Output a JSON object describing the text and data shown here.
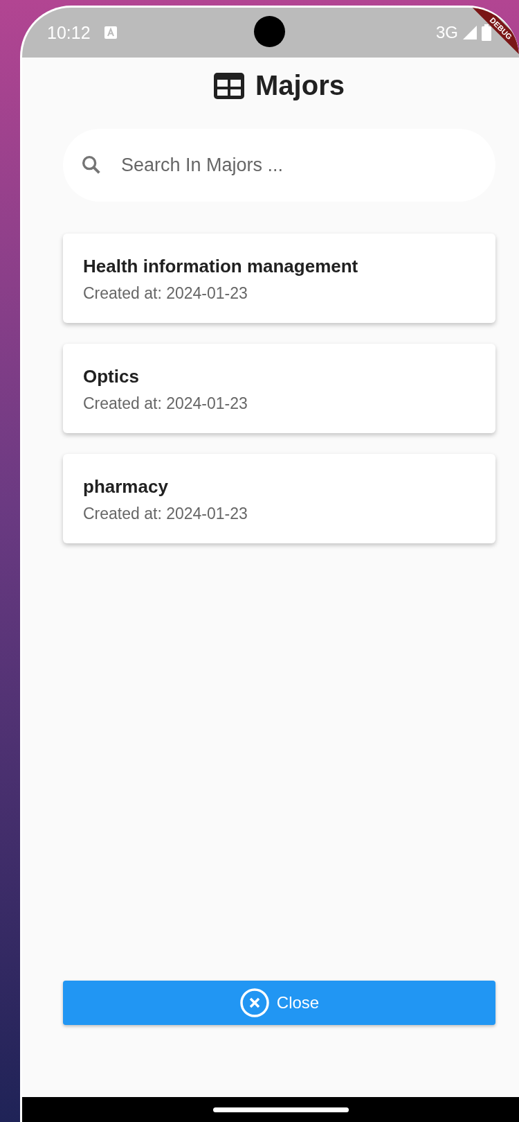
{
  "status_bar": {
    "time": "10:12",
    "network": "3G"
  },
  "debug_banner": "DEBUG",
  "header": {
    "title": "Majors"
  },
  "search": {
    "placeholder": "Search In Majors ..."
  },
  "majors": [
    {
      "name": "Health information management",
      "created": "Created at: 2024-01-23"
    },
    {
      "name": "Optics",
      "created": "Created at: 2024-01-23"
    },
    {
      "name": "pharmacy",
      "created": "Created at: 2024-01-23"
    }
  ],
  "close_button": {
    "label": "Close"
  }
}
